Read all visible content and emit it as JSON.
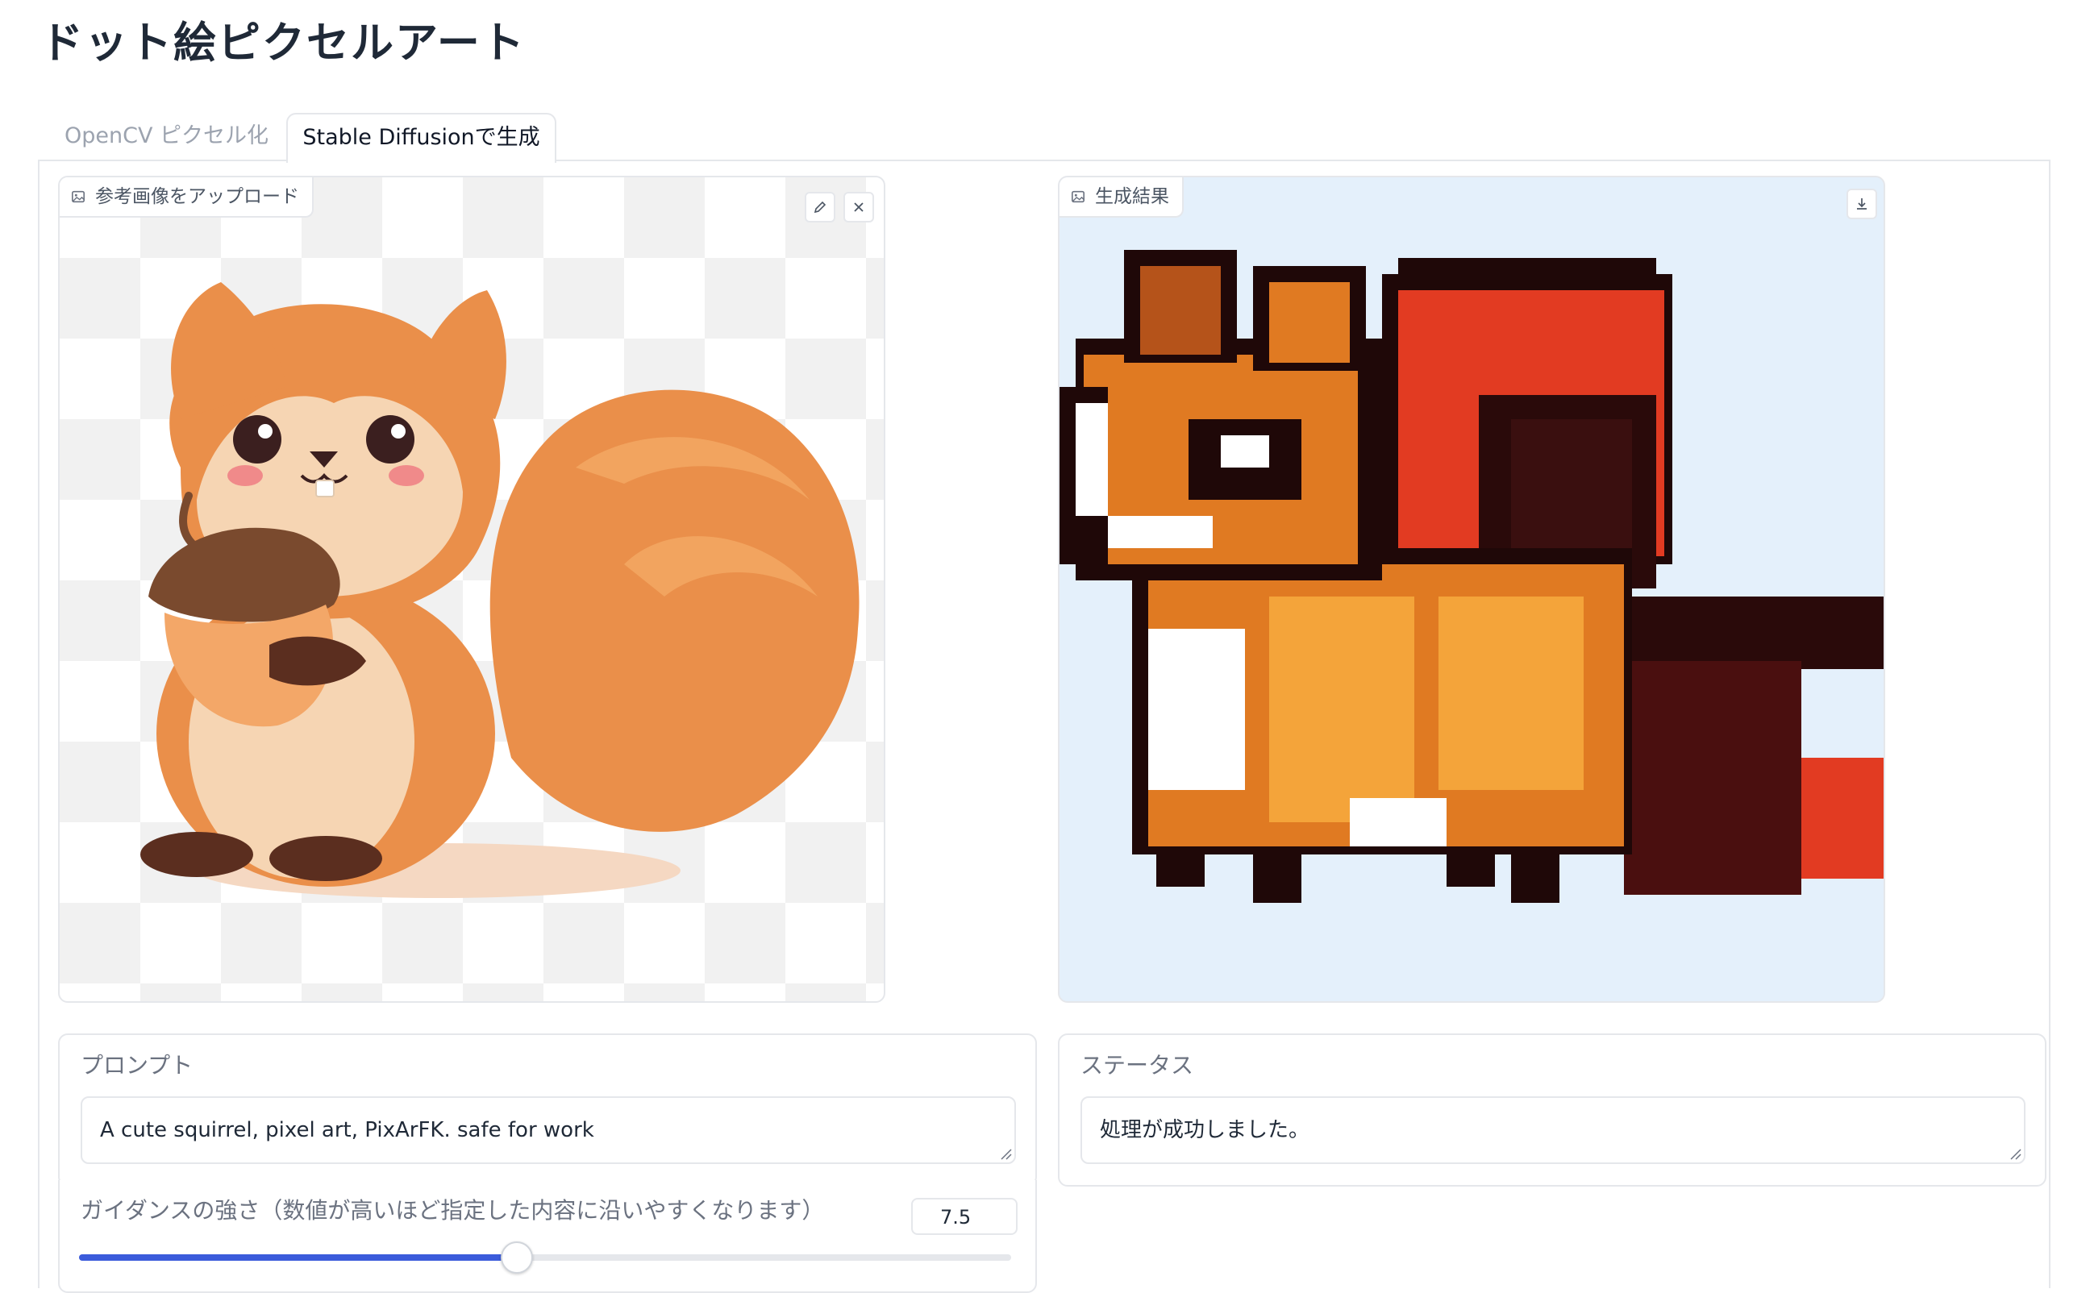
{
  "app": {
    "title": "ドット絵ピクセルアート"
  },
  "tabs": [
    {
      "label": "OpenCV ピクセル化",
      "selected": false
    },
    {
      "label": "Stable Diffusionで生成",
      "selected": true
    }
  ],
  "upload": {
    "label": "参考画像をアップロード",
    "edit_icon": "pencil-icon",
    "clear_icon": "close-icon"
  },
  "result": {
    "label": "生成結果",
    "download_icon": "download-icon"
  },
  "prompt": {
    "label": "プロンプト",
    "value": "A cute squirrel, pixel art, PixArFK. safe for work"
  },
  "status": {
    "label": "ステータス",
    "value": "処理が成功しました。"
  },
  "guidance": {
    "label": "ガイダンスの強さ（数値が高いほど指定した内容に沿いやすくなります）",
    "value": "7.5",
    "fill_percent": 47
  },
  "colors": {
    "accent": "#3b5bdb",
    "border": "#e5e7eb"
  }
}
